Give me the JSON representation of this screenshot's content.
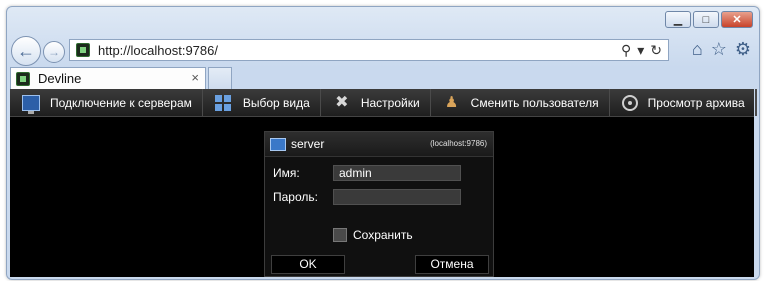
{
  "browser": {
    "url_prefix": "http://",
    "url_host": "localhost",
    "url_rest": ":9786/",
    "tab_title": "Devline",
    "tab_close": "×",
    "controls": {
      "minimize": "▁",
      "maximize": "□",
      "close": "✕"
    },
    "addr_tools": {
      "search": "⚲",
      "dropdown": "▾",
      "refresh": "↻"
    },
    "icons": {
      "home": "⌂",
      "favorites": "☆",
      "settings": "⚙"
    }
  },
  "toolbar": {
    "items": [
      {
        "label": "Подключение к серверам",
        "icon": "monitor-icon"
      },
      {
        "label": "Выбор вида",
        "icon": "grid-icon"
      },
      {
        "label": "Настройки",
        "icon": "tools-icon"
      },
      {
        "label": "Сменить пользователя",
        "icon": "user-icon"
      },
      {
        "label": "Просмотр архива",
        "icon": "film-icon"
      }
    ],
    "pin_icon": "pin-icon"
  },
  "dialog": {
    "title": "server",
    "host": "(localhost:9786)",
    "username_label": "Имя:",
    "username_value": "admin",
    "password_label": "Пароль:",
    "password_value": "",
    "remember_label": "Сохранить",
    "ok_label": "OK",
    "cancel_label": "Отмена"
  }
}
